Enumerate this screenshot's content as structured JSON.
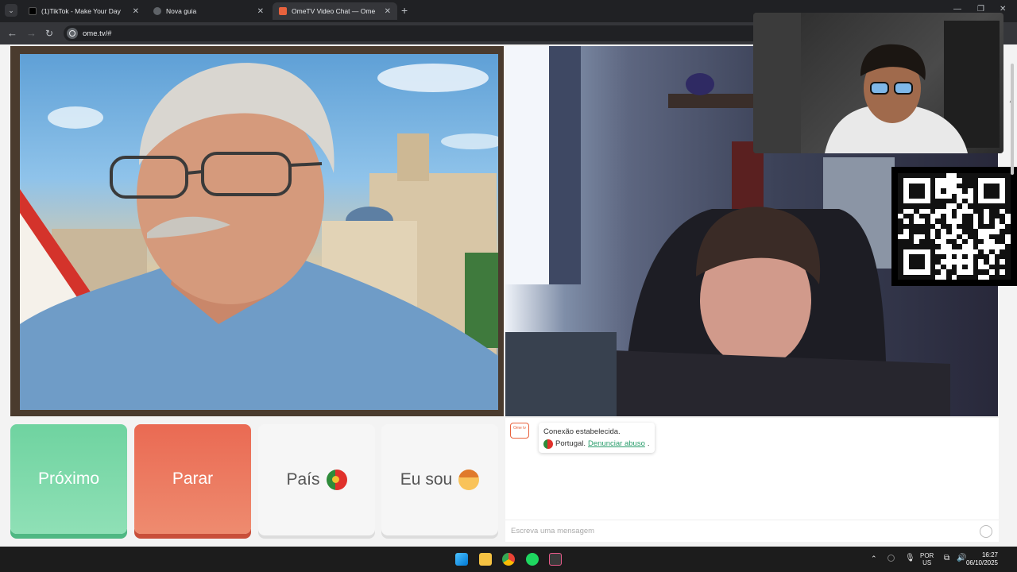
{
  "browser": {
    "tabs": [
      {
        "title": "(1)TikTok - Make Your Day",
        "active": false,
        "favicon_color": "#000000"
      },
      {
        "title": "Nova guia",
        "active": false,
        "favicon_color": "#5f6368"
      },
      {
        "title": "OmeTV Video Chat — Ome",
        "active": true,
        "favicon_color": "#e8623d"
      }
    ],
    "url": "ome.tv/#"
  },
  "actions": {
    "next_label": "Próximo",
    "stop_label": "Parar",
    "country_label": "País",
    "iam_label": "Eu sou"
  },
  "chat": {
    "logo_text": "Ome tv",
    "connected_text": "Conexão estabelecida.",
    "country_text": "Portugal.",
    "report_link": "Denunciar abuso",
    "report_suffix": ".",
    "input_placeholder": "Escreva uma mensagem"
  },
  "taskbar": {
    "language_top": "POR",
    "language_bottom": "US",
    "time": "16:27",
    "date": "06/10/2025"
  },
  "colors": {
    "next_button": "#7ad9a8",
    "stop_button": "#ec7a60",
    "link": "#2a9d6c"
  }
}
